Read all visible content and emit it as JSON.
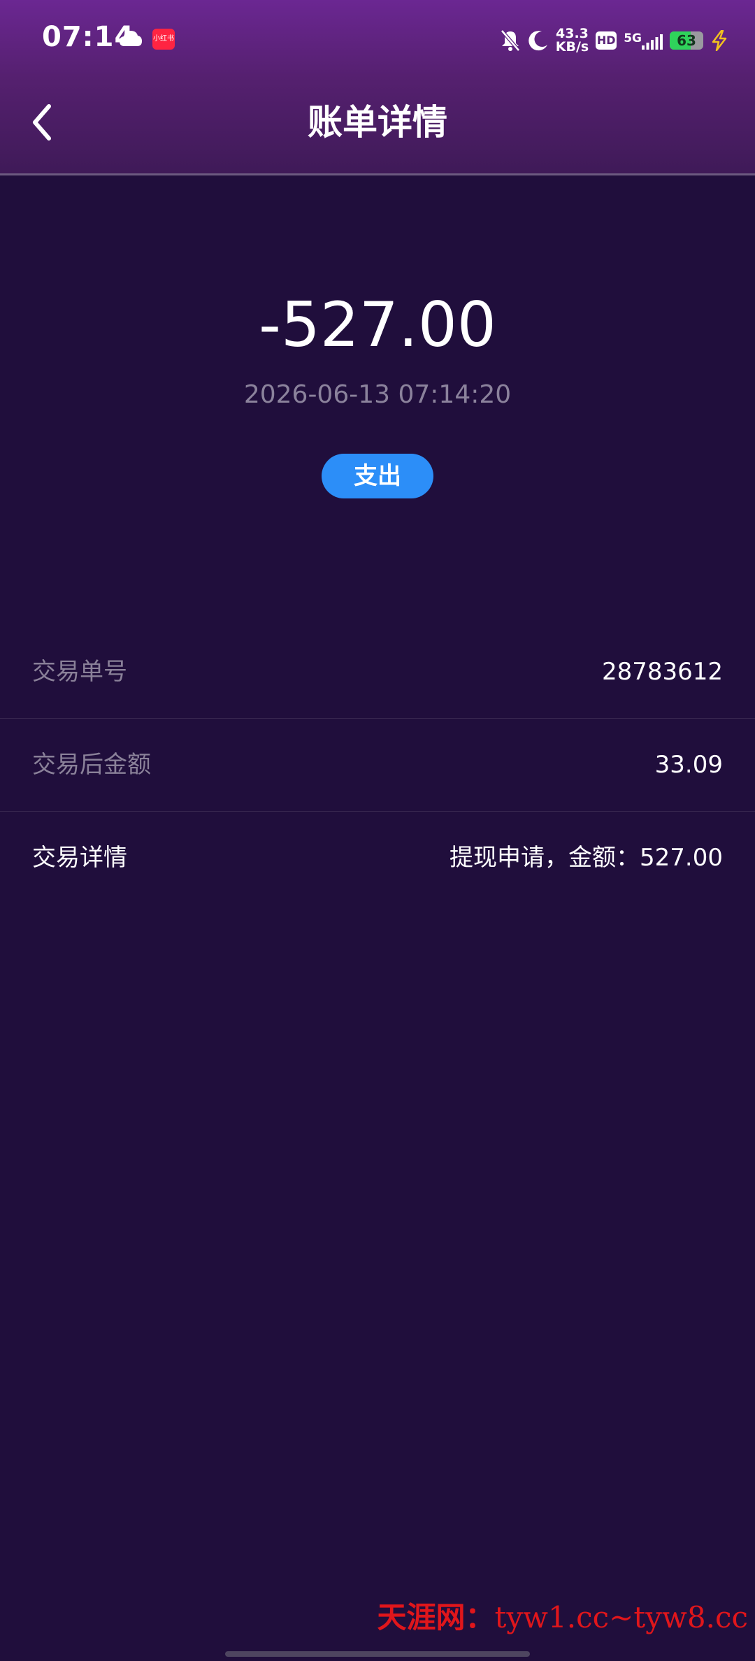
{
  "status_bar": {
    "time": "07:14",
    "app_icon_text": "小红书",
    "net_speed_value": "43.3",
    "net_speed_unit": "KB/s",
    "hd_label": "HD",
    "network_label": "5G",
    "battery_level": "63",
    "icons": [
      "cloud-icon",
      "app-notification-icon",
      "mute-bell-icon",
      "moon-icon",
      "hd-icon",
      "signal-icon",
      "battery-icon",
      "charging-icon"
    ]
  },
  "header": {
    "title": "账单详情",
    "back_icon": "chevron-left-icon"
  },
  "transaction": {
    "amount": "-527.00",
    "datetime": "2026-06-13 07:14:20",
    "type_label": "支出"
  },
  "details": [
    {
      "label": "交易单号",
      "value": "28783612"
    },
    {
      "label": "交易后金额",
      "value": "33.09"
    },
    {
      "label": "交易详情",
      "value": "提现申请，金额：527.00"
    }
  ],
  "watermark": {
    "site_name": "天涯网：",
    "domains": "tyw1.cc~tyw8.cc"
  },
  "colors": {
    "background": "#200e3c",
    "header_top": "#6b2792",
    "header_bottom": "#3f1a58",
    "badge": "#2c8ef8",
    "muted_text": "#8a8199",
    "watermark": "#e0161b",
    "battery_fill": "#2fd35b"
  }
}
